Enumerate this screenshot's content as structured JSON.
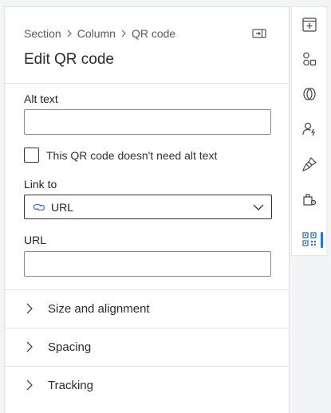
{
  "panel": {
    "breadcrumb": [
      "Section",
      "Column",
      "QR code"
    ],
    "title": "Edit QR code",
    "alt_text": {
      "label": "Alt text",
      "value": ""
    },
    "no_alt_checkbox": {
      "label": "This QR code doesn't need alt text",
      "checked": false
    },
    "link_to": {
      "label": "Link to",
      "value": "URL",
      "icon": "link-icon"
    },
    "url": {
      "label": "URL",
      "value": ""
    },
    "sections": [
      {
        "label": "Size and alignment",
        "expanded": false
      },
      {
        "label": "Spacing",
        "expanded": false
      },
      {
        "label": "Tracking",
        "expanded": false
      }
    ]
  },
  "rail": {
    "items": [
      {
        "icon": "add-content-icon"
      },
      {
        "icon": "elements-icon"
      },
      {
        "icon": "layers-icon"
      },
      {
        "icon": "personalization-icon"
      },
      {
        "icon": "styles-brush-icon"
      },
      {
        "icon": "assets-settings-icon"
      },
      {
        "icon": "qr-code-icon",
        "active": true
      }
    ]
  },
  "colors": {
    "accent": "#2f6fde",
    "link_icon": "#4a6fcf"
  }
}
